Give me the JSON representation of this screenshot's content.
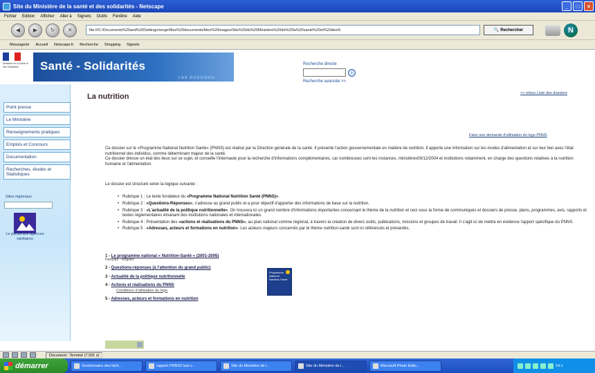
{
  "window": {
    "title": "Site du Ministère de la santé et des solidarités - Netscape"
  },
  "menu": [
    "Fichier",
    "Edition",
    "Afficher",
    "Aller à",
    "Signets",
    "Outils",
    "Fenêtre",
    "Aide"
  ],
  "navigation": {
    "url": "file:///C:/Documents%20and%20Settings/serge/Mes%20documents/Mes%20images/Site%20du%20Ministère%20de%20la%20santé%20et%20des%",
    "search_button": "Rechercher"
  },
  "personal_toolbar": [
    "Messagerie",
    "Accueil",
    "Netscape.fr",
    "Recherche",
    "Shopping",
    "Signets"
  ],
  "header": {
    "gov_logo_text": "Ministère de la Santé et des Solidarités",
    "site_title": "Santé - Solidarités",
    "dossiers_tab": "LES DOSSIERS",
    "search_direct_label": "Recherche directe",
    "search_go": "ok",
    "advanced_search": "Recherche avancée >>"
  },
  "sidebar": {
    "items": [
      "Point presse",
      "Le Ministère",
      "Renseignements pratiques",
      "Emplois et Concours",
      "Documentation",
      "Recherches, études et Statistiques"
    ],
    "sites_label": "Sites régionaux",
    "portal_text": "Le portail des agences sanitaires"
  },
  "content": {
    "page_title": "La nutrition",
    "back_link": "<< retour Liste des dossiers",
    "logo_request": "Faire une demande d'utilisation du logo PNNS",
    "intro": "Ce dossier sur le «Programme National Nutrition Santé» (PNNS) est réalisé par la Direction générale de la santé. Il présente l'action gouvernementale en matière de nutrition. Il apporte une information sur les modes d'alimentation et sur leur lien avec l'état nutritionnel des individus, comme déterminant majeur de la santé.",
    "intro2": "Ce dossier dresse un état des lieux sur ce sujet, et conseille l'internaute pour la recherche d'informations complémentaires, car nombreuses sont les instances, ministères09/12/2004 et institutions notamment, en charge des questions relatives à la nutrition humaine et l'alimentation.",
    "structure_intro": "Le dossier est structuré selon la logique suivante :",
    "rubriques": [
      {
        "prefix": "Rubrique 1 : Le texte fondateur du ",
        "bold": "«Programme National Nutrition Santé (PNNS)»",
        "suffix": "."
      },
      {
        "prefix": "Rubrique 2 : ",
        "bold": "«Questions-Réponses»",
        "suffix": ", s'adresse au grand public et a pour objectif d'apporter des informations de base sur la nutrition."
      },
      {
        "prefix": "Rubrique 3 : ",
        "bold": "«L'actualité de la politique nutritionnelle»",
        "suffix": ". On trouvera ici un grand nombre d'informations importantes concernant le thème de la nutrition et ceci sous la forme de communiqués et dossiers de presse, plans, programmes, avis, rapports et textes réglementaires émanant des institutions nationales et internationales."
      },
      {
        "prefix": "Rubrique 4 : Présentation des ",
        "bold": "«actions et réalisations du PNNS»",
        "suffix": ", au plan national comme régional, à travers la création de divers outils, publications, missions et groupes de travail. Il s'agit ici de mettre en évidence l'apport spécifique du PNNS."
      },
      {
        "prefix": "Rubrique 5 : ",
        "bold": "«Adresses, acteurs et formations en nutrition»",
        "suffix": ". Les acteurs majeurs concernés par le thème nutrition-santé sont ici référencés et présentés."
      }
    ],
    "toc": [
      {
        "num": "1 - ",
        "link": "Le programme national « Nutrition-Santé » (2001-2005)",
        "sub": "français - english"
      },
      {
        "num": "2 - ",
        "link": "Questions-réponses (à l'attention du grand public)",
        "sub": ""
      },
      {
        "num": "3 - ",
        "link": "Actualité de la politique nutritionnelle",
        "sub": ""
      },
      {
        "num": "4 - ",
        "link": "Actions et réalisations du PNNS",
        "sub": "Conditions d'utilisation du logo"
      },
      {
        "num": "5 - ",
        "link": "Adresses, acteurs et formations en nutrition",
        "sub": ""
      }
    ],
    "pnns_logo_text": "Programme National Nutrition Santé"
  },
  "statusbar": {
    "text": "Document : Terminé (7.931 s)"
  },
  "taskbar": {
    "start": "démarrer",
    "tasks": [
      "Gestionnaire des tâch...",
      "rapport PNNS2 last v...",
      "Site du Ministère de l...",
      "Site du Ministère de l...",
      "Microsoft Photo Editc..."
    ],
    "clock": "14:1"
  },
  "colors": {
    "banner_blue": "#1c4f9c",
    "sidebar_bg": "#dbeefb",
    "taskbar_blue": "#3168d5",
    "start_green": "#3fa33a"
  }
}
